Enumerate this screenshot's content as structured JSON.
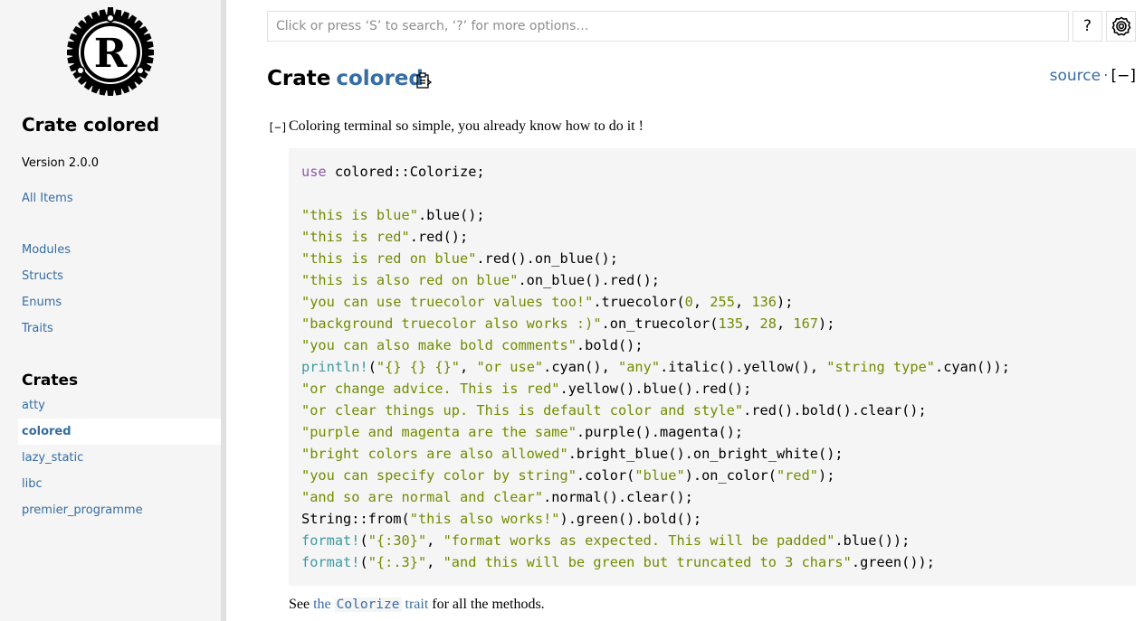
{
  "sidebar": {
    "crate_title": "Crate colored",
    "version": "Version 2.0.0",
    "all_items": "All Items",
    "sections": [
      "Modules",
      "Structs",
      "Enums",
      "Traits"
    ],
    "crates_heading": "Crates",
    "crates": [
      "atty",
      "colored",
      "lazy_static",
      "libc",
      "premier_programme"
    ],
    "current_crate": "colored"
  },
  "search": {
    "placeholder": "Click or press ‘S’ to search, ‘?’ for more options…",
    "value": ""
  },
  "toolbar": {
    "help_label": "?"
  },
  "header": {
    "prefix": "Crate",
    "name": "colored",
    "source_label": "source",
    "separator": "·",
    "toggle_label": "[−]"
  },
  "doc": {
    "collapse_label": "[−]",
    "description": "Coloring terminal so simple, you already know how to do it !",
    "see_prefix": "See",
    "see_link_the": "the",
    "see_link_code": "Colorize",
    "see_link_trait": "trait",
    "see_suffix": "for all the methods."
  },
  "code_lines": [
    [
      [
        "kw",
        "use"
      ],
      [
        "p",
        " colored::Colorize;"
      ]
    ],
    [],
    [
      [
        "st",
        "\"this is blue\""
      ],
      [
        "p",
        ".blue();"
      ]
    ],
    [
      [
        "st",
        "\"this is red\""
      ],
      [
        "p",
        ".red();"
      ]
    ],
    [
      [
        "st",
        "\"this is red on blue\""
      ],
      [
        "p",
        ".red().on_blue();"
      ]
    ],
    [
      [
        "st",
        "\"this is also red on blue\""
      ],
      [
        "p",
        ".on_blue().red();"
      ]
    ],
    [
      [
        "st",
        "\"you can use truecolor values too!\""
      ],
      [
        "p",
        ".truecolor("
      ],
      [
        "num",
        "0"
      ],
      [
        "p",
        ", "
      ],
      [
        "num",
        "255"
      ],
      [
        "p",
        ", "
      ],
      [
        "num",
        "136"
      ],
      [
        "p",
        ");"
      ]
    ],
    [
      [
        "st",
        "\"background truecolor also works :)\""
      ],
      [
        "p",
        ".on_truecolor("
      ],
      [
        "num",
        "135"
      ],
      [
        "p",
        ", "
      ],
      [
        "num",
        "28"
      ],
      [
        "p",
        ", "
      ],
      [
        "num",
        "167"
      ],
      [
        "p",
        ");"
      ]
    ],
    [
      [
        "st",
        "\"you can also make bold comments\""
      ],
      [
        "p",
        ".bold();"
      ]
    ],
    [
      [
        "mac",
        "println!"
      ],
      [
        "p",
        "("
      ],
      [
        "st",
        "\"{} {} {}\""
      ],
      [
        "p",
        ", "
      ],
      [
        "st",
        "\"or use\""
      ],
      [
        "p",
        ".cyan(), "
      ],
      [
        "st",
        "\"any\""
      ],
      [
        "p",
        ".italic().yellow(), "
      ],
      [
        "st",
        "\"string type\""
      ],
      [
        "p",
        ".cyan());"
      ]
    ],
    [
      [
        "st",
        "\"or change advice. This is red\""
      ],
      [
        "p",
        ".yellow().blue().red();"
      ]
    ],
    [
      [
        "st",
        "\"or clear things up. This is default color and style\""
      ],
      [
        "p",
        ".red().bold().clear();"
      ]
    ],
    [
      [
        "st",
        "\"purple and magenta are the same\""
      ],
      [
        "p",
        ".purple().magenta();"
      ]
    ],
    [
      [
        "st",
        "\"bright colors are also allowed\""
      ],
      [
        "p",
        ".bright_blue().on_bright_white();"
      ]
    ],
    [
      [
        "st",
        "\"you can specify color by string\""
      ],
      [
        "p",
        ".color("
      ],
      [
        "st",
        "\"blue\""
      ],
      [
        "p",
        ").on_color("
      ],
      [
        "st",
        "\"red\""
      ],
      [
        "p",
        ");"
      ]
    ],
    [
      [
        "st",
        "\"and so are normal and clear\""
      ],
      [
        "p",
        ".normal().clear();"
      ]
    ],
    [
      [
        "p",
        "String::from("
      ],
      [
        "st",
        "\"this also works!\""
      ],
      [
        "p",
        ").green().bold();"
      ]
    ],
    [
      [
        "mac",
        "format!"
      ],
      [
        "p",
        "("
      ],
      [
        "st",
        "\"{:30}\""
      ],
      [
        "p",
        ", "
      ],
      [
        "st",
        "\"format works as expected. This will be padded\""
      ],
      [
        "p",
        ".blue());"
      ]
    ],
    [
      [
        "mac",
        "format!"
      ],
      [
        "p",
        "("
      ],
      [
        "st",
        "\"{:.3}\""
      ],
      [
        "p",
        ", "
      ],
      [
        "st",
        "\"and this will be green but truncated to 3 chars\""
      ],
      [
        "p",
        ".green());"
      ]
    ]
  ],
  "colors": {
    "link": "#356da4",
    "keyword": "#8959a8",
    "string": "#718c00",
    "macro": "#3e999f",
    "sidebar_bg": "#f5f5f5"
  }
}
